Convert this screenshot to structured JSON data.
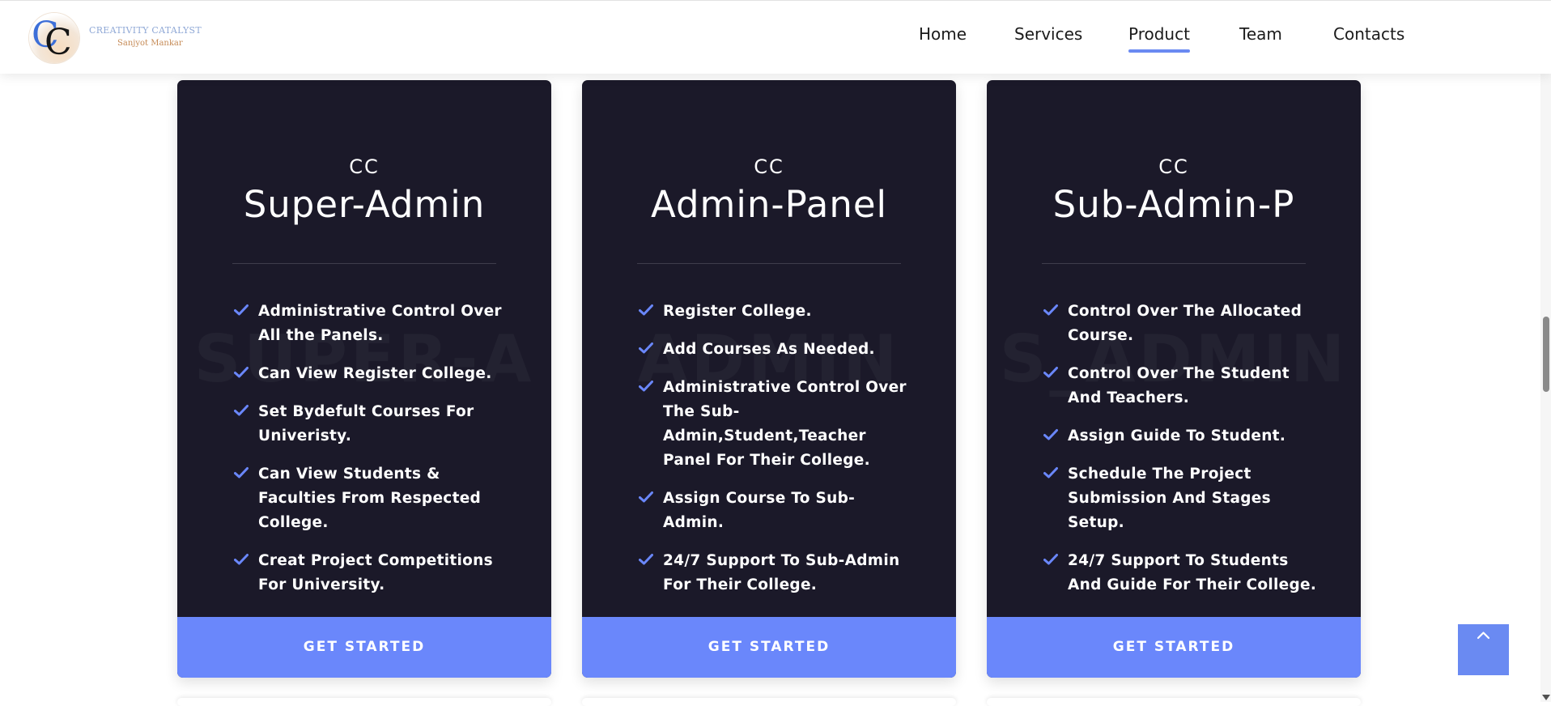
{
  "header": {
    "logo": {
      "mark": [
        "C",
        "C"
      ],
      "title": "CREATIVITY CATALYST",
      "subtitle": "Sanjyot Mankar"
    },
    "nav": [
      {
        "label": "Home",
        "active": false
      },
      {
        "label": "Services",
        "active": false
      },
      {
        "label": "Product",
        "active": true
      },
      {
        "label": "Team",
        "active": false
      },
      {
        "label": "Contacts",
        "active": false
      }
    ]
  },
  "cards": [
    {
      "kicker": "CC",
      "title": "Super-Admin",
      "watermark": "SUPER-A",
      "features": [
        "Administrative Control Over All the Panels.",
        "Can View Register College.",
        "Set Bydefult Courses For Univeristy.",
        "Can View Students & Faculties From Respected College.",
        "Creat Project Competitions For University."
      ],
      "cta": "GET STARTED"
    },
    {
      "kicker": "CC",
      "title": "Admin-Panel",
      "watermark": "ADMIN",
      "features": [
        "Register College.",
        "Add Courses As Needed.",
        "Administrative Control Over The Sub-Admin,Student,Teacher Panel For Their College.",
        "Assign Course To Sub-Admin.",
        "24/7 Support To Sub-Admin For Their College."
      ],
      "cta": "GET STARTED"
    },
    {
      "kicker": "CC",
      "title": "Sub-Admin-P",
      "watermark": "S_ADMIN",
      "features": [
        "Control Over The Allocated Course.",
        "Control Over The Student And Teachers.",
        "Assign Guide To Student.",
        "Schedule The Project Submission And Stages Setup.",
        "24/7 Support To Students And Guide For Their College."
      ],
      "cta": "GET STARTED"
    }
  ],
  "colors": {
    "card_bg": "#1b1929",
    "accent": "#6a87fb",
    "nav_underline": "#6a8af2"
  },
  "icons": {
    "feature_bullet": "check-icon",
    "back_to_top": "chevron-up-icon"
  }
}
